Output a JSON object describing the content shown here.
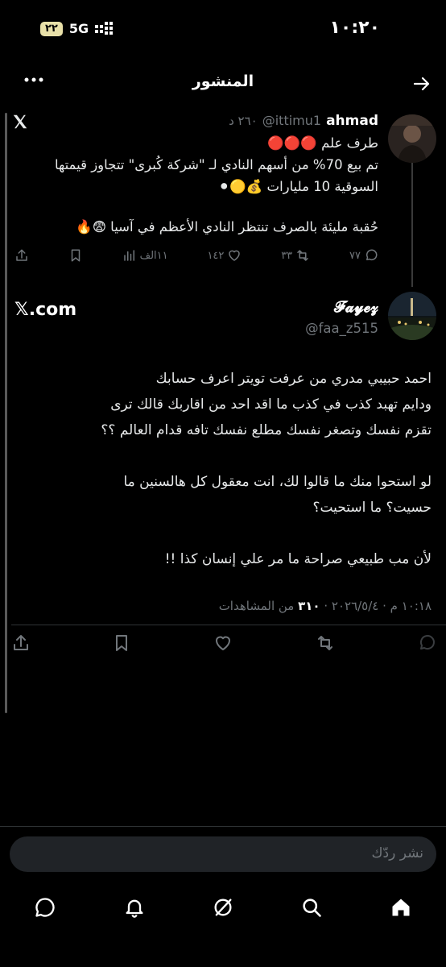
{
  "status": {
    "time": "١٠:٢٠",
    "battery": "٢٢",
    "network": "5G"
  },
  "header": {
    "title": "المنشور"
  },
  "quoted": {
    "name": "ahmad",
    "handle": "@ittimu1",
    "time": "٢٦٠ د",
    "line1": "طرف علم 🔴🔴🔴",
    "line2": "تم بيع 70% من أسهم النادي لـ \"شركة كُبرى\" تتجاوز قيمتها",
    "line3": "السوقية 10 مليارات 💰🟡⚫",
    "line4": "حُقبة مليئة بالصرف تنتظر النادي الأعظم في آسيا 😨🔥",
    "replies": "٧٧",
    "reposts": "٣٣",
    "likes": "١٤٢",
    "views": "١١الف"
  },
  "post": {
    "name": "𝓕𝓪𝔂𝓮𝔃",
    "handle": "@faa_z515",
    "source": "𝕏.com",
    "lines": [
      "احمد حبيبي مدري من عرفت تويتر اعرف حسابك",
      "ودايم تهبد كذب في كذب ما اقد احد من اقاربك قالك ترى",
      "تقزم نفسك وتصغر نفسك مطلع نفسك تافه قدام العالم ؟؟",
      "",
      "لو استحوا منك ما قالوا لك، انت معقول كل هالسنين ما",
      "حسيت؟ ما استحيت؟",
      "",
      "لأن مب طبيعي صراحة ما مر علي إنسان كذا !!"
    ],
    "timestamp": "١٠:١٨ م · ٢٠٢٦/٥/٤ · ",
    "views_count": "٣١٠",
    "views_label": "من المشاهدات"
  },
  "reply": {
    "placeholder": "نشر ردّك"
  },
  "colors": {
    "bg": "#000000",
    "text": "#e7e9ea",
    "muted": "#71767b",
    "divider": "#2f3336"
  }
}
